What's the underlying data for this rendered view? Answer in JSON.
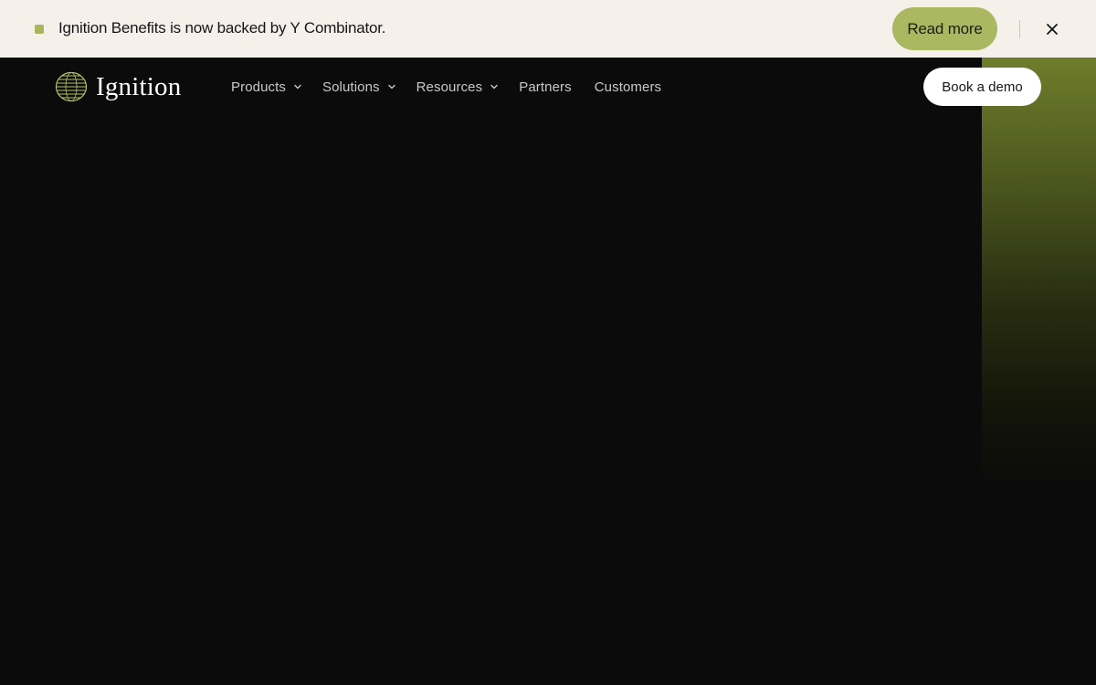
{
  "banner": {
    "message": "Ignition Benefits is now backed by Y Combinator.",
    "read_more_label": "Read more",
    "close_icon": "close-icon",
    "accent_color": "#a7b65a"
  },
  "nav": {
    "logo_text": "Ignition",
    "logo_icon": "ignition-logo-icon",
    "items": [
      {
        "label": "Products",
        "has_dropdown": true
      },
      {
        "label": "Solutions",
        "has_dropdown": true
      },
      {
        "label": "Resources",
        "has_dropdown": true
      },
      {
        "label": "Partners",
        "has_dropdown": false
      },
      {
        "label": "Customers",
        "has_dropdown": false
      }
    ],
    "cta_label": "Book a demo"
  },
  "colors": {
    "banner_bg": "#f5f0ea",
    "hero_bg": "#0b0b0b",
    "accent": "#abb862",
    "gradient_top": "#6f7d2c"
  }
}
